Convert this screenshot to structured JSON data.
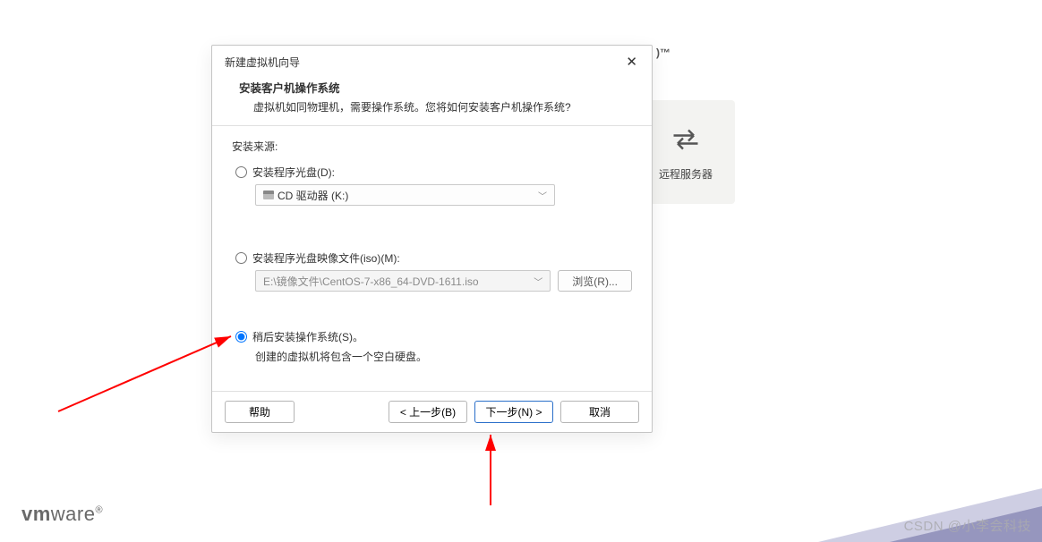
{
  "background": {
    "tm": ")™",
    "remote_card": "远程服务器"
  },
  "dialog": {
    "title": "新建虚拟机向导",
    "header_title": "安装客户机操作系统",
    "header_sub": "虚拟机如同物理机，需要操作系统。您将如何安装客户机操作系统?",
    "source_label": "安装来源:",
    "opt1_label": "安装程序光盘(D):",
    "opt1_combo": "CD 驱动器 (K:)",
    "opt2_label": "安装程序光盘映像文件(iso)(M):",
    "opt2_combo": "E:\\镜像文件\\CentOS-7-x86_64-DVD-1611.iso",
    "browse": "浏览(R)...",
    "opt3_label": "稍后安装操作系统(S)。",
    "opt3_desc": "创建的虚拟机将包含一个空白硬盘。",
    "help": "帮助",
    "back": "< 上一步(B)",
    "next": "下一步(N) >",
    "cancel": "取消"
  },
  "logo": "vmware",
  "watermark": "CSDN @小李会科技"
}
